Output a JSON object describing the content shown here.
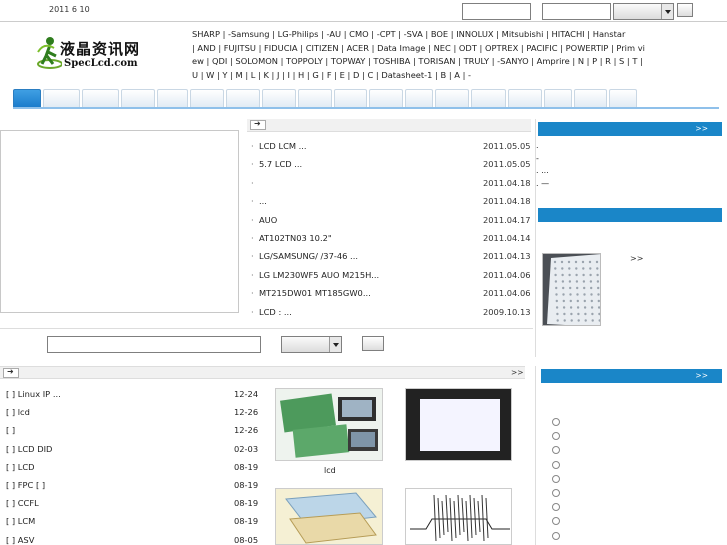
{
  "topbar": {
    "date": "2011 6 10",
    "input_1_value": "",
    "input_2_value": "",
    "select_value": "",
    "button_label": ""
  },
  "logo": {
    "zh": "液晶资讯网",
    "en": "SpecLcd.com"
  },
  "brands": [
    "SHARP |",
    "-Samsung |",
    "LG-Philips |",
    "-AU |",
    "CMO |",
    "-CPT |",
    "-SVA |",
    "BOE |",
    "INNOLUX |",
    "Mitsubishi |",
    "HITACHI |",
    "Hanstar",
    "| AND |",
    "FUJITSU |",
    "FIDUCIA |",
    "CITIZEN |",
    "ACER |",
    "Data Image |",
    "NEC |",
    "ODT |",
    "OPTREX |",
    "PACIFIC |",
    "POWERTIP |",
    "Prim vi",
    "ew |",
    "QDI |",
    "SOLOMON |",
    "TOPPOLY |",
    "TOPWAY |",
    "TOSHIBA |",
    "TORISAN |",
    "TRULY |",
    "-SANYO |",
    "Amprire |",
    "N | P | R | S | T |",
    "U | W | Y | M | L | K | J | I | H | G | F | E | D | C |",
    "Datasheet-1 |",
    "B | A |",
    "-"
  ],
  "nav_tabs": [
    "",
    "",
    "",
    "",
    "",
    "",
    "",
    "",
    "",
    "",
    "",
    "",
    "",
    "",
    "",
    "",
    "",
    ""
  ],
  "news": [
    {
      "title": "LCD LCM      ...",
      "date": "2011.05.05"
    },
    {
      "title": "5.7   LCD   ...",
      "date": "2011.05.05"
    },
    {
      "title": "",
      "date": "2011.04.18"
    },
    {
      "title": "          ...",
      "date": "2011.04.18"
    },
    {
      "title": "        AUO",
      "date": "2011.04.17"
    },
    {
      "title": "AT102TN03 10.2\"",
      "date": "2011.04.14"
    },
    {
      "title": "LG/SAMSUNG/  /37-46   ...",
      "date": "2011.04.13"
    },
    {
      "title": "LG LM230WF5 AUO M215H...",
      "date": "2011.04.06"
    },
    {
      "title": "  MT215DW01 MT185GW0...",
      "date": "2011.04.06"
    },
    {
      "title": "LCD  :      ...",
      "date": "2009.10.13"
    }
  ],
  "search": {
    "input_value": "",
    "select_value": "",
    "button_label": ""
  },
  "right": {
    "more_1": ">>",
    "lines": [
      ".",
      "    -",
      ". ...",
      ".    —"
    ],
    "more_2": ">>"
  },
  "tips": {
    "more": ">>",
    "items": [
      {
        "title": "[   ] Linux  IP      ...",
        "date": "12-24"
      },
      {
        "title": "[   ]     lcd",
        "date": "12-26"
      },
      {
        "title": "[   ]",
        "date": "12-26"
      },
      {
        "title": "[   ] LCD DID",
        "date": "02-03"
      },
      {
        "title": "[   ] LCD",
        "date": "08-19"
      },
      {
        "title": "[   ] FPC        [   ]",
        "date": "08-19"
      },
      {
        "title": "[   ] CCFL",
        "date": "08-19"
      },
      {
        "title": "[   ] LCM",
        "date": "08-19"
      },
      {
        "title": "[   ]     ASV",
        "date": "08-05"
      }
    ],
    "thumb_1_caption": "lcd"
  },
  "poll": {
    "more": ">>",
    "option_count": 9
  },
  "colors": {
    "accent_blue": "#1a86c8",
    "tab_active": "#1b7ccc"
  }
}
